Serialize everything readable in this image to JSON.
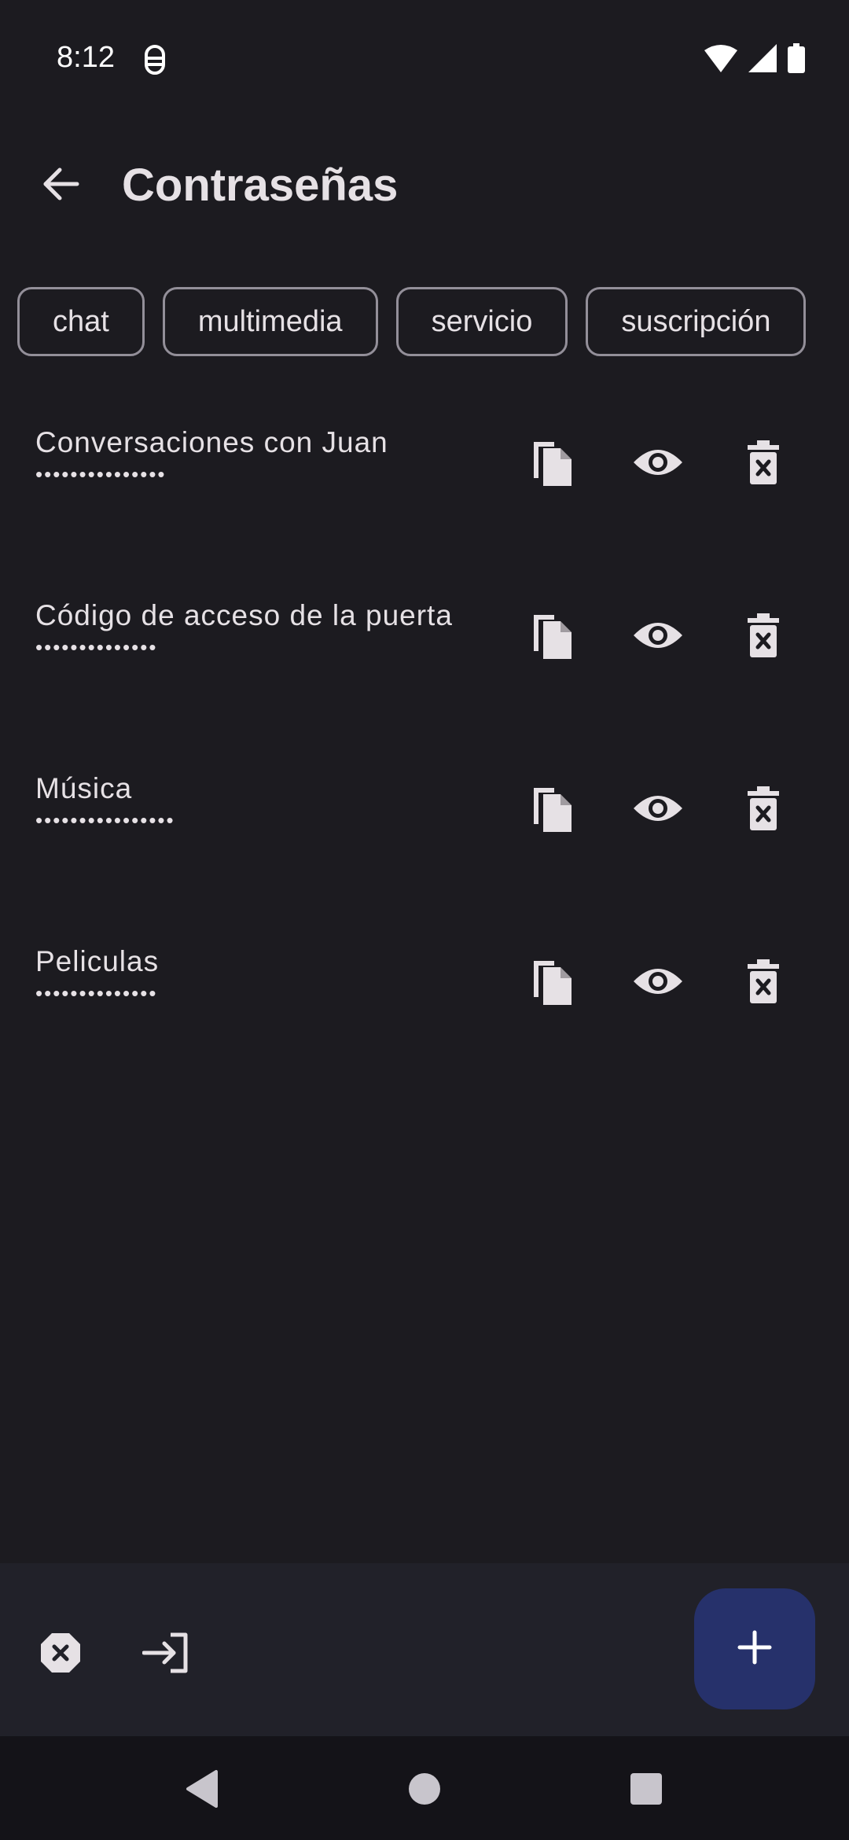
{
  "status_bar": {
    "time": "8:12"
  },
  "header": {
    "title": "Contraseñas"
  },
  "chips": [
    {
      "label": "chat"
    },
    {
      "label": "multimedia"
    },
    {
      "label": "servicio"
    },
    {
      "label": "suscripción"
    }
  ],
  "passwords": [
    {
      "title": "Conversaciones con Juan",
      "masked": "•••••••••••••••"
    },
    {
      "title": "Código de acceso de la puerta",
      "masked": "••••••••••••••"
    },
    {
      "title": "Música",
      "masked": "••••••••••••••••"
    },
    {
      "title": "Peliculas",
      "masked": "••••••••••••••"
    }
  ],
  "colors": {
    "background": "#1c1b20",
    "bottom_bar": "#212129",
    "fab": "#26316b",
    "chip_border": "#938f99",
    "text": "#e6e1e5"
  },
  "icons": {
    "back": "arrow-back-icon",
    "copy": "copy-icon",
    "show": "eye-icon",
    "delete": "trash-x-icon",
    "clear": "octagon-x-icon",
    "logout": "login-arrow-icon",
    "add": "plus-icon"
  }
}
